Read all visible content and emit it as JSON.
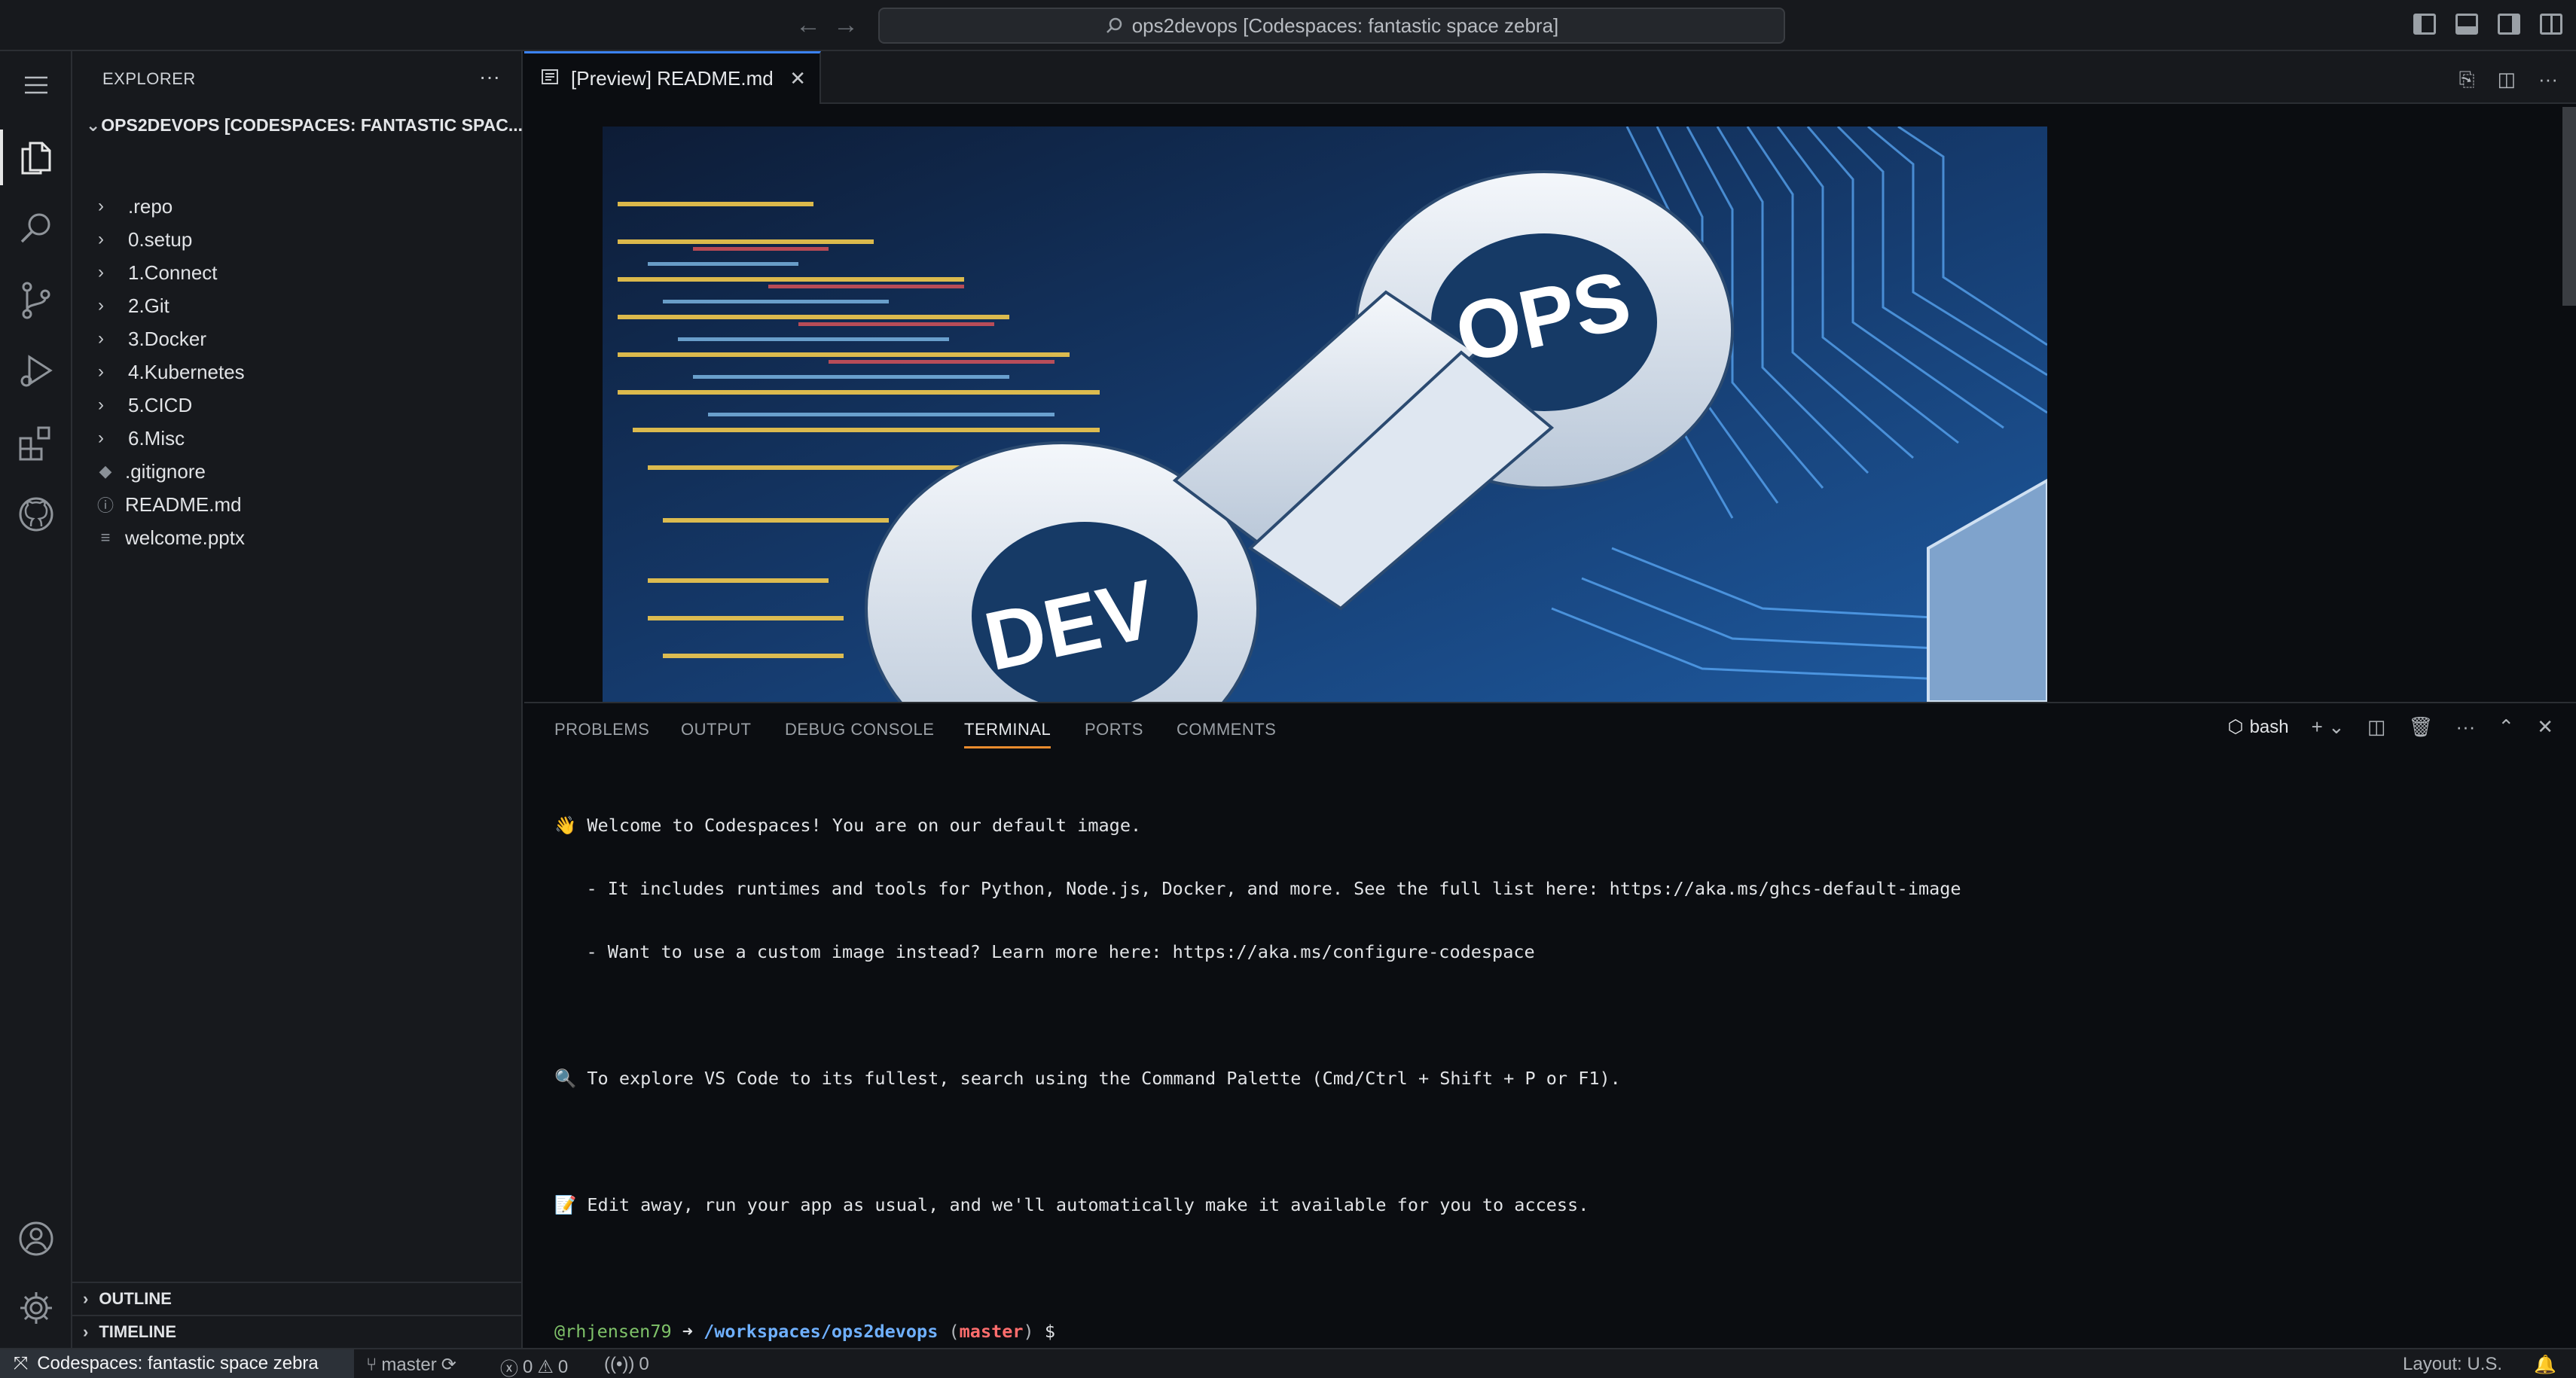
{
  "titlebar": {
    "back_icon": "arrow-left-icon",
    "forward_icon": "arrow-right-icon",
    "command_center": "ops2devops [Codespaces: fantastic space zebra]"
  },
  "activity_bar": {
    "items": [
      "explorer",
      "search",
      "source-control",
      "run-and-debug",
      "extensions",
      "github"
    ],
    "bottom": [
      "accounts",
      "manage"
    ]
  },
  "sidebar": {
    "title": "EXPLORER",
    "more": "···",
    "root_folder": "OPS2DEVOPS [CODESPACES: FANTASTIC SPAC...",
    "folders": [
      ".repo",
      "0.setup",
      "1.Connect",
      "2.Git",
      "3.Docker",
      "4.Kubernetes",
      "5.CICD",
      "6.Misc"
    ],
    "files": [
      {
        "name": ".gitignore",
        "icon": "diamond-icon"
      },
      {
        "name": "README.md",
        "icon": "info-icon"
      },
      {
        "name": "welcome.pptx",
        "icon": "lines-icon"
      }
    ],
    "outline": "OUTLINE",
    "timeline": "TIMELINE"
  },
  "editor": {
    "tab_label": "[Preview] README.md",
    "hero_text_dev": "DEV",
    "hero_text_ops": "OPS"
  },
  "panel": {
    "tabs": [
      "PROBLEMS",
      "OUTPUT",
      "DEBUG CONSOLE",
      "TERMINAL",
      "PORTS",
      "COMMENTS"
    ],
    "active_tab": "TERMINAL",
    "shell": "bash"
  },
  "terminal": {
    "line1": "👋 Welcome to Codespaces! You are on our default image.",
    "line2": "   - It includes runtimes and tools for Python, Node.js, Docker, and more. See the full list here: https://aka.ms/ghcs-default-image",
    "line3": "   - Want to use a custom image instead? Learn more here: https://aka.ms/configure-codespace",
    "line4": "🔍 To explore VS Code to its fullest, search using the Command Palette (Cmd/Ctrl + Shift + P or F1).",
    "line5": "📝 Edit away, run your app as usual, and we'll automatically make it available for you to access.",
    "prompt_user": "@rhjensen79",
    "prompt_arrow": " ➜ ",
    "prompt_path": "/workspaces/ops2devops",
    "prompt_open": " (",
    "prompt_branch": "master",
    "prompt_close": ")",
    "prompt_dollar": " $"
  },
  "statusbar": {
    "remote": "Codespaces: fantastic space zebra",
    "branch": "master",
    "errors": "0",
    "warnings": "0",
    "ports": "0",
    "layout": "Layout: U.S."
  }
}
